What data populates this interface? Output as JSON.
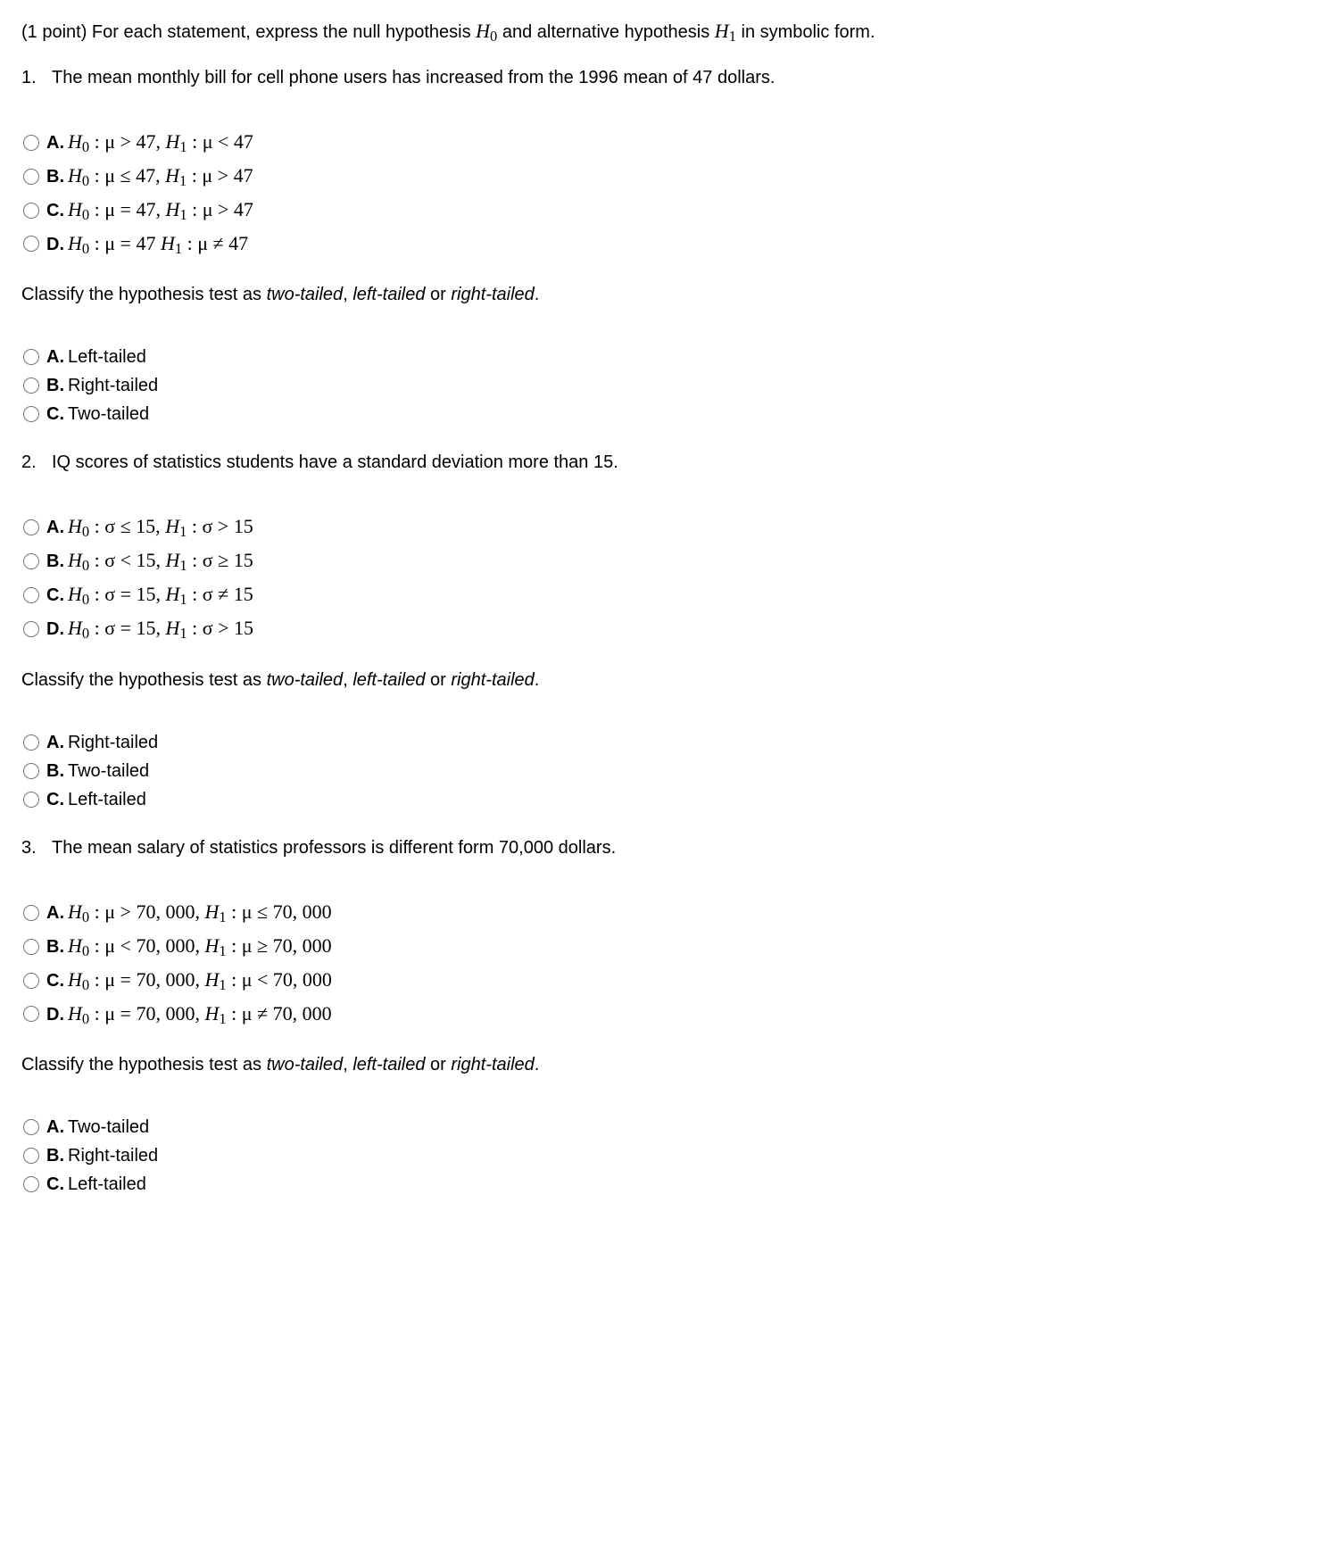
{
  "intro_lead": "(1 point) For each statement, express the null hypothesis ",
  "intro_mid": " and alternative hypothesis ",
  "intro_tail": " in symbolic form.",
  "sym_H0": "H",
  "sym_H0_sub": "0",
  "sym_H1": "H",
  "sym_H1_sub": "1",
  "classify_lead": "Classify the hypothesis test as ",
  "classify_two": "two-tailed",
  "classify_sep1": ", ",
  "classify_left": "left-tailed",
  "classify_sep2": " or ",
  "classify_right": "right-tailed",
  "classify_end": ".",
  "q1": {
    "num": "1.",
    "text": "The mean monthly bill for cell phone users has increased from the 1996 mean of 47 dollars.",
    "optA_letter": "A.",
    "optA_a": "H",
    "optA_b": "0",
    "optA_c": " : μ > 47,  ",
    "optA_d": "H",
    "optA_e": "1",
    "optA_f": " : μ < 47",
    "optB_letter": "B.",
    "optB_a": "H",
    "optB_b": "0",
    "optB_c": " : μ ≤ 47,  ",
    "optB_d": "H",
    "optB_e": "1",
    "optB_f": " : μ > 47",
    "optC_letter": "C.",
    "optC_a": "H",
    "optC_b": "0",
    "optC_c": " : μ = 47,  ",
    "optC_d": "H",
    "optC_e": "1",
    "optC_f": " : μ > 47",
    "optD_letter": "D.",
    "optD_a": "H",
    "optD_b": "0",
    "optD_c": " : μ = 47  ",
    "optD_d": "H",
    "optD_e": "1",
    "optD_f": " : μ ≠ 47",
    "tailA_letter": "A.",
    "tailA_text": "Left-tailed",
    "tailB_letter": "B.",
    "tailB_text": "Right-tailed",
    "tailC_letter": "C.",
    "tailC_text": "Two-tailed"
  },
  "q2": {
    "num": "2.",
    "text": "IQ scores of statistics students have a standard deviation more than 15.",
    "optA_letter": "A.",
    "optA_a": "H",
    "optA_b": "0",
    "optA_c": " : σ ≤ 15,  ",
    "optA_d": "H",
    "optA_e": "1",
    "optA_f": " : σ > 15",
    "optB_letter": "B.",
    "optB_a": "H",
    "optB_b": "0",
    "optB_c": " : σ < 15,  ",
    "optB_d": "H",
    "optB_e": "1",
    "optB_f": " : σ ≥ 15",
    "optC_letter": "C.",
    "optC_a": "H",
    "optC_b": "0",
    "optC_c": " : σ = 15,  ",
    "optC_d": "H",
    "optC_e": "1",
    "optC_f": " : σ ≠ 15",
    "optD_letter": "D.",
    "optD_a": "H",
    "optD_b": "0",
    "optD_c": " : σ = 15,  ",
    "optD_d": "H",
    "optD_e": "1",
    "optD_f": " : σ > 15",
    "tailA_letter": "A.",
    "tailA_text": "Right-tailed",
    "tailB_letter": "B.",
    "tailB_text": "Two-tailed",
    "tailC_letter": "C.",
    "tailC_text": "Left-tailed"
  },
  "q3": {
    "num": "3.",
    "text": "The mean salary of statistics professors is different form 70,000 dollars.",
    "optA_letter": "A.",
    "optA_a": "H",
    "optA_b": "0",
    "optA_c": " : μ > 70, 000,  ",
    "optA_d": "H",
    "optA_e": "1",
    "optA_f": " : μ ≤ 70, 000",
    "optB_letter": "B.",
    "optB_a": "H",
    "optB_b": "0",
    "optB_c": " : μ < 70, 000,  ",
    "optB_d": "H",
    "optB_e": "1",
    "optB_f": " : μ ≥ 70, 000",
    "optC_letter": "C.",
    "optC_a": "H",
    "optC_b": "0",
    "optC_c": " : μ = 70, 000,  ",
    "optC_d": "H",
    "optC_e": "1",
    "optC_f": " : μ < 70, 000",
    "optD_letter": "D.",
    "optD_a": "H",
    "optD_b": "0",
    "optD_c": " : μ = 70, 000,  ",
    "optD_d": "H",
    "optD_e": "1",
    "optD_f": " : μ ≠ 70, 000",
    "tailA_letter": "A.",
    "tailA_text": "Two-tailed",
    "tailB_letter": "B.",
    "tailB_text": "Right-tailed",
    "tailC_letter": "C.",
    "tailC_text": "Left-tailed"
  }
}
